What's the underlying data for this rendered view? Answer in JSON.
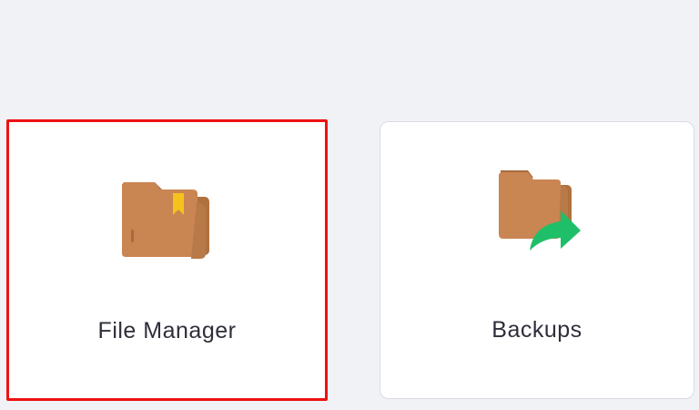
{
  "cards": [
    {
      "label": "File Manager",
      "icon": "folder-bookmark-icon",
      "selected": true,
      "highlight_color": "#ee1111"
    },
    {
      "label": "Backups",
      "icon": "folder-share-arrow-icon",
      "selected": false
    }
  ],
  "colors": {
    "background": "#f1f2f6",
    "card": "#ffffff",
    "folder": "#c98552",
    "folder_dark": "#a86b3f",
    "bookmark": "#f6c21c",
    "arrow": "#1fbf6a"
  }
}
